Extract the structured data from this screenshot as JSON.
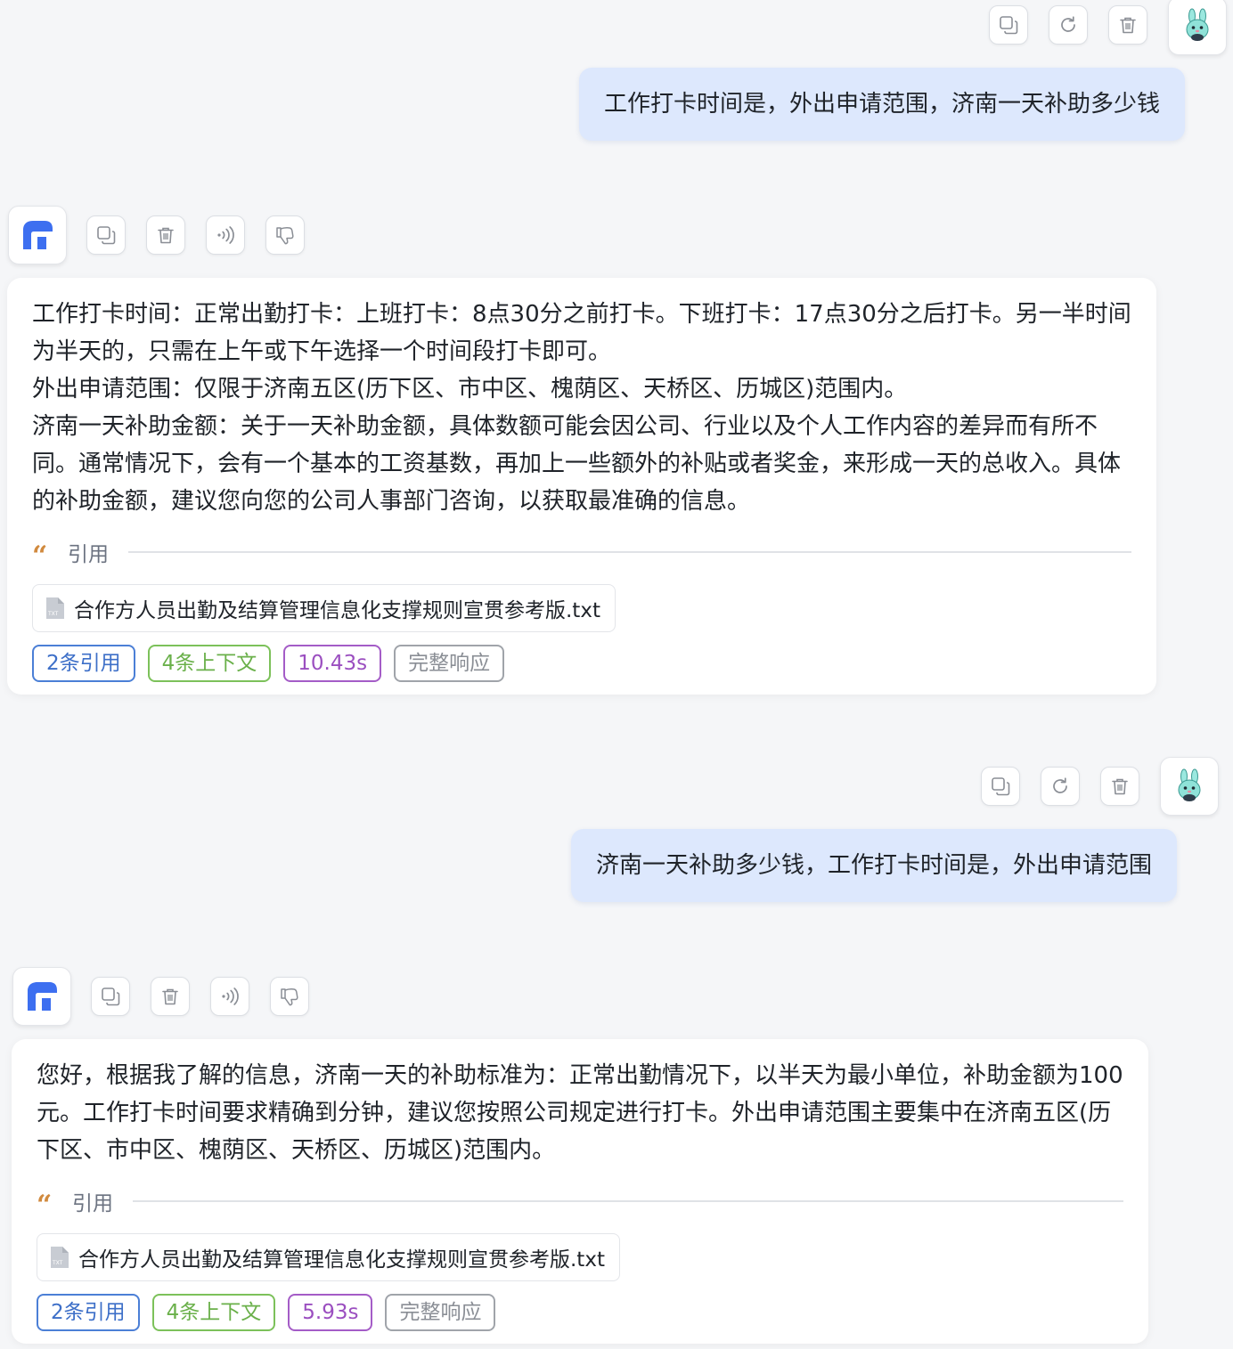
{
  "messages": [
    {
      "role": "user",
      "text": "工作打卡时间是，外出申请范围，济南一天补助多少钱"
    },
    {
      "role": "assistant",
      "paragraphs": [
        "工作打卡时间：正常出勤打卡：上班打卡：8点30分之前打卡。下班打卡：17点30分之后打卡。另一半时间为半天的，只需在上午或下午选择一个时间段打卡即可。",
        "外出申请范围：仅限于济南五区(历下区、市中区、槐荫区、天桥区、历城区)范围内。",
        "济南一天补助金额：关于一天补助金额，具体数额可能会因公司、行业以及个人工作内容的差异而有所不同。通常情况下，会有一个基本的工资基数，再加上一些额外的补贴或者奖金，来形成一天的总收入。具体的补助金额，建议您向您的公司人事部门咨询，以获取最准确的信息。"
      ],
      "citation_label": "引用",
      "file_name": "合作方人员出勤及结算管理信息化支撑规则宣贯参考版.txt",
      "tags": {
        "references": "2条引用",
        "context": "4条上下文",
        "time": "10.43s",
        "full_response": "完整响应"
      }
    },
    {
      "role": "user",
      "text": "济南一天补助多少钱，工作打卡时间是，外出申请范围"
    },
    {
      "role": "assistant",
      "paragraphs": [
        "您好，根据我了解的信息，济南一天的补助标准为：正常出勤情况下，以半天为最小单位，补助金额为100元。工作打卡时间要求精确到分钟，建议您按照公司规定进行打卡。外出申请范围主要集中在济南五区(历下区、市中区、槐荫区、天桥区、历城区)范围内。"
      ],
      "citation_label": "引用",
      "file_name": "合作方人员出勤及结算管理信息化支撑规则宣贯参考版.txt",
      "tags": {
        "references": "2条引用",
        "context": "4条上下文",
        "time": "5.93s",
        "full_response": "完整响应"
      }
    }
  ],
  "icons": {
    "user_actions": [
      "copy-icon",
      "refresh-icon",
      "delete-icon"
    ],
    "bot_actions": [
      "copy-icon",
      "delete-icon",
      "speaker-icon",
      "thumbs-down-icon"
    ],
    "user_avatar": "bunny-avatar",
    "bot_avatar": "app-logo"
  },
  "colors": {
    "user_bubble": "#dde8fd",
    "tag_references": "#4b7fd6",
    "tag_context": "#7cc15a",
    "tag_time": "#a45cc7",
    "tag_full_response": "#a0a4aa",
    "quote_mark": "#d18a3e",
    "logo_blue": "#3d6ff0"
  }
}
